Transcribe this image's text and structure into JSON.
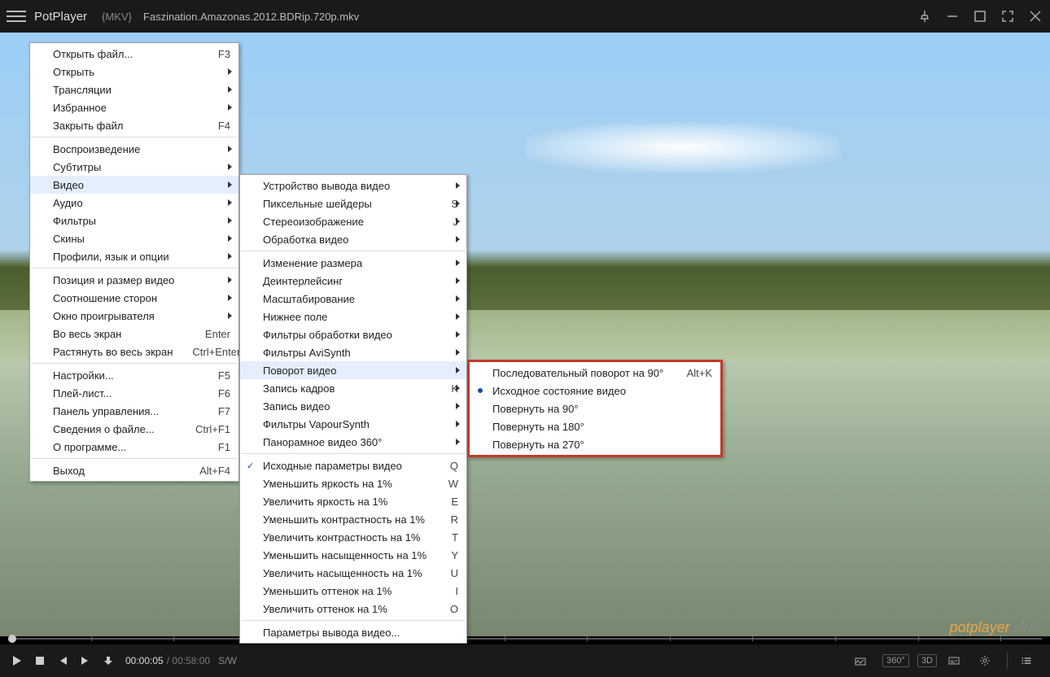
{
  "title": {
    "app": "PotPlayer",
    "tag": "{MKV}",
    "file": "Faszination.Amazonas.2012.BDRip.720p.mkv"
  },
  "controls": {
    "time_current": "00:00:05",
    "time_duration": "00:58:00",
    "sw": "S/W",
    "r360": "360°",
    "r3d": "3D"
  },
  "watermark": {
    "a": "potplayer",
    "b": ".club"
  },
  "menu1": [
    {
      "label": "Открыть файл...",
      "short": "F3"
    },
    {
      "label": "Открыть",
      "sub": true
    },
    {
      "label": "Трансляции",
      "sub": true
    },
    {
      "label": "Избранное",
      "sub": true
    },
    {
      "label": "Закрыть файл",
      "short": "F4"
    },
    {
      "sep": true
    },
    {
      "label": "Воспроизведение",
      "sub": true
    },
    {
      "label": "Субтитры",
      "sub": true
    },
    {
      "label": "Видео",
      "sub": true,
      "hl": true
    },
    {
      "label": "Аудио",
      "sub": true
    },
    {
      "label": "Фильтры",
      "sub": true
    },
    {
      "label": "Скины",
      "sub": true
    },
    {
      "label": "Профили, язык и опции",
      "sub": true
    },
    {
      "sep": true
    },
    {
      "label": "Позиция и размер видео",
      "sub": true
    },
    {
      "label": "Соотношение сторон",
      "sub": true
    },
    {
      "label": "Окно проигрывателя",
      "sub": true
    },
    {
      "label": "Во весь экран",
      "short": "Enter"
    },
    {
      "label": "Растянуть во весь экран",
      "short": "Ctrl+Enter"
    },
    {
      "sep": true
    },
    {
      "label": "Настройки...",
      "short": "F5"
    },
    {
      "label": "Плей-лист...",
      "short": "F6"
    },
    {
      "label": "Панель управления...",
      "short": "F7"
    },
    {
      "label": "Сведения о файле...",
      "short": "Ctrl+F1"
    },
    {
      "label": "О программе...",
      "short": "F1"
    },
    {
      "sep": true
    },
    {
      "label": "Выход",
      "short": "Alt+F4"
    }
  ],
  "menu2": [
    {
      "label": "Устройство вывода видео",
      "sub": true
    },
    {
      "label": "Пиксельные шейдеры",
      "short": "S",
      "sub": true
    },
    {
      "label": "Стереоизображение",
      "short": "J",
      "sub": true
    },
    {
      "label": "Обработка видео",
      "sub": true
    },
    {
      "sep": true
    },
    {
      "label": "Изменение размера",
      "sub": true
    },
    {
      "label": "Деинтерлейсинг",
      "sub": true
    },
    {
      "label": "Масштабирование",
      "sub": true
    },
    {
      "label": "Нижнее поле",
      "sub": true
    },
    {
      "label": "Фильтры обработки видео",
      "sub": true
    },
    {
      "label": "Фильтры AviSynth",
      "sub": true
    },
    {
      "label": "Поворот видео",
      "sub": true,
      "hl": true
    },
    {
      "label": "Запись кадров",
      "short": "K",
      "sub": true
    },
    {
      "label": "Запись видео",
      "sub": true
    },
    {
      "label": "Фильтры VapourSynth",
      "sub": true
    },
    {
      "label": "Панорамное видео 360°",
      "sub": true
    },
    {
      "sep": true
    },
    {
      "label": "Исходные параметры видео",
      "short": "Q",
      "check": true
    },
    {
      "label": "Уменьшить яркость на 1%",
      "short": "W"
    },
    {
      "label": "Увеличить яркость на 1%",
      "short": "E"
    },
    {
      "label": "Уменьшить контрастность на 1%",
      "short": "R"
    },
    {
      "label": "Увеличить контрастность на 1%",
      "short": "T"
    },
    {
      "label": "Уменьшить насыщенность на 1%",
      "short": "Y"
    },
    {
      "label": "Увеличить насыщенность на 1%",
      "short": "U"
    },
    {
      "label": "Уменьшить оттенок на 1%",
      "short": "I"
    },
    {
      "label": "Увеличить оттенок на 1%",
      "short": "O"
    },
    {
      "sep": true
    },
    {
      "label": "Параметры вывода видео..."
    }
  ],
  "menu3": [
    {
      "label": "Последовательный поворот на 90°",
      "short": "Alt+K"
    },
    {
      "label": "Исходное состояние видео",
      "radio": true
    },
    {
      "label": "Повернуть на 90°"
    },
    {
      "label": "Повернуть на 180°"
    },
    {
      "label": "Повернуть на 270°"
    }
  ]
}
